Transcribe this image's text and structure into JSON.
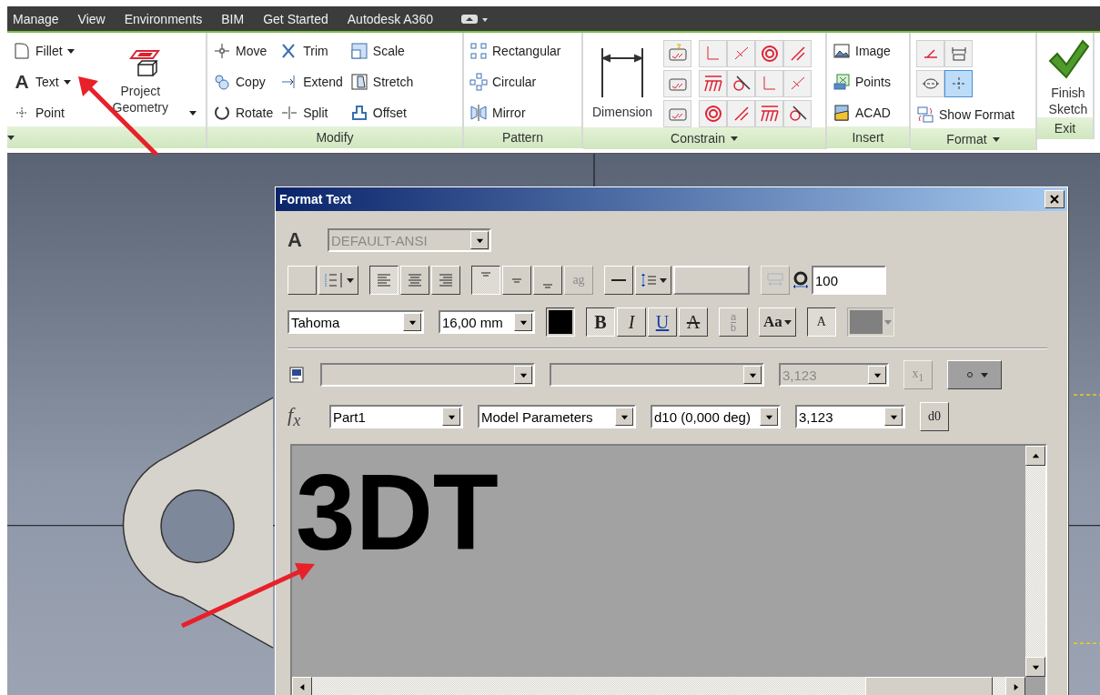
{
  "menu_tabs": [
    "Manage",
    "View",
    "Environments",
    "BIM",
    "Get Started",
    "Autodesk A360"
  ],
  "ribbon": [
    {
      "menu": true,
      "sections": [
        {
          "kind": "tools",
          "items": [
            {
              "label": "Fillet",
              "dropdown": true
            },
            {
              "label": "Text",
              "glyph": "A",
              "dropdown": true
            },
            {
              "label": "Point",
              "dropdown": false
            }
          ]
        },
        {
          "kind": "large",
          "label": "Project Geometry",
          "dropdown": true
        }
      ]
    },
    {
      "title": "Modify",
      "menu": false,
      "sections": [
        {
          "kind": "tools",
          "items": [
            {
              "label": "Move",
              "dropdown": false
            },
            {
              "label": "Copy",
              "dropdown": false
            },
            {
              "label": "Rotate",
              "dropdown": false
            }
          ]
        },
        {
          "kind": "tools",
          "items": [
            {
              "label": "Trim",
              "dropdown": false
            },
            {
              "label": "Extend",
              "dropdown": false
            },
            {
              "label": "Split",
              "dropdown": false
            }
          ]
        },
        {
          "kind": "tools",
          "items": [
            {
              "label": "Scale",
              "dropdown": false
            },
            {
              "label": "Stretch",
              "dropdown": false
            },
            {
              "label": "Offset",
              "dropdown": false
            }
          ]
        }
      ]
    },
    {
      "title": "Pattern",
      "menu": false,
      "sections": [
        {
          "kind": "tools",
          "items": [
            {
              "label": "Rectangular",
              "dropdown": false
            },
            {
              "label": "Circular",
              "dropdown": false
            },
            {
              "label": "Mirror",
              "dropdown": false
            }
          ]
        }
      ]
    },
    {
      "title": "Constrain",
      "menu": true,
      "sections": [
        {
          "kind": "large",
          "label": "Dimension",
          "dropdown": false
        },
        {
          "kind": "grid",
          "rows": [
            [
              {
                "selected": false
              }
            ],
            [
              {
                "selected": false
              }
            ],
            [
              {
                "selected": false
              }
            ]
          ]
        },
        {
          "kind": "grid",
          "rows": [
            [
              {
                "selected": false
              },
              {
                "selected": false
              },
              {
                "selected": false
              },
              {
                "selected": false
              }
            ],
            [
              {
                "selected": false
              },
              {
                "selected": false
              },
              {
                "selected": false
              },
              {
                "selected": false
              }
            ],
            [
              {
                "selected": false
              },
              {
                "selected": false
              },
              {
                "selected": false
              },
              {
                "selected": false
              }
            ]
          ]
        }
      ]
    },
    {
      "title": "Insert",
      "menu": false,
      "sections": [
        {
          "kind": "tools",
          "items": [
            {
              "label": "Image",
              "dropdown": false
            },
            {
              "label": "Points",
              "dropdown": false
            },
            {
              "label": "ACAD",
              "dropdown": false
            }
          ]
        }
      ]
    },
    {
      "title": "Format",
      "menu": true,
      "sections": [
        {
          "kind": "grid",
          "rows": [
            [
              {
                "selected": false
              },
              {
                "selected": false
              }
            ],
            [
              {
                "selected": false
              },
              {
                "selected": true
              }
            ]
          ],
          "items": [
            {
              "label": "Show Format",
              "dropdown": false
            }
          ]
        }
      ]
    },
    {
      "title": "Exit",
      "menu": false,
      "sections": [
        {
          "kind": "large",
          "label": "Finish Sketch",
          "dropdown": false
        }
      ]
    }
  ],
  "dialog": {
    "title": "Format Text",
    "style_row": {
      "glyph": "A",
      "combo": {
        "kind": "combo",
        "value": "DEFAULT-ANSI",
        "disabled": true
      }
    },
    "paragraph_row": [
      [
        {
          "kind": "button",
          "selected": false,
          "disabled": false
        },
        {
          "kind": "menu-button",
          "selected": false,
          "disabled": false
        }
      ],
      [
        {
          "kind": "button",
          "selected": true,
          "disabled": false
        },
        {
          "kind": "button",
          "selected": false,
          "disabled": false
        },
        {
          "kind": "button",
          "selected": false,
          "disabled": false
        }
      ],
      [
        {
          "kind": "button",
          "selected": true,
          "disabled": false
        },
        {
          "kind": "button",
          "selected": false,
          "disabled": false
        },
        {
          "kind": "button",
          "selected": false,
          "disabled": false
        },
        {
          "kind": "button",
          "glyph": "ag",
          "selected": false,
          "disabled": true
        }
      ],
      [
        {
          "kind": "button",
          "selected": false,
          "disabled": false
        },
        {
          "kind": "menu-button",
          "selected": false,
          "disabled": false
        },
        {
          "kind": "field",
          "disabled": true
        }
      ],
      [
        {
          "kind": "button",
          "selected": false,
          "disabled": true
        },
        {
          "kind": "icon"
        },
        {
          "kind": "field",
          "value": "100",
          "disabled": false
        }
      ]
    ],
    "font_row": [
      [
        {
          "kind": "combo",
          "value": "Tahoma",
          "disabled": false
        },
        {
          "kind": "combo",
          "value": "16,00 mm",
          "disabled": false
        }
      ],
      [
        {
          "kind": "swatch",
          "color": "#000000",
          "dropdown": false,
          "disabled": false
        }
      ],
      [
        {
          "kind": "button",
          "glyph": "B",
          "selected": true,
          "disabled": false
        },
        {
          "kind": "button",
          "glyph": "I",
          "selected": false,
          "disabled": false
        },
        {
          "kind": "button",
          "glyph": "U",
          "selected": false,
          "disabled": false
        },
        {
          "kind": "button",
          "glyph": "A",
          "selected": false,
          "disabled": false
        }
      ],
      [
        {
          "kind": "stack",
          "top": "a",
          "bottom": "b",
          "disabled": true
        }
      ],
      [
        {
          "kind": "menu-button",
          "glyph": "Aa",
          "selected": false,
          "disabled": false
        }
      ],
      [
        {
          "kind": "button",
          "glyph": "A",
          "selected": true,
          "disabled": false
        }
      ],
      [
        {
          "kind": "swatch",
          "color": "#808080",
          "dropdown": true,
          "disabled": true
        }
      ]
    ],
    "parameter_rows": [
      [
        {
          "kind": "icon"
        },
        {
          "kind": "combo",
          "disabled": true
        },
        {
          "kind": "combo",
          "disabled": true
        },
        {
          "kind": "combo",
          "value": "3,123",
          "disabled": true
        },
        {
          "kind": "button",
          "glyph": "x$_{1}$",
          "selected": false,
          "disabled": true
        },
        {
          "kind": "menu-button",
          "selected": false,
          "disabled": false
        }
      ],
      [
        {
          "kind": "label",
          "glyph": "f$_{x}$"
        },
        {
          "kind": "combo",
          "value": "Part1",
          "disabled": false
        },
        {
          "kind": "combo",
          "value": "Model Parameters",
          "disabled": false
        },
        {
          "kind": "combo",
          "value": "d10 (0,000 deg)",
          "disabled": false
        },
        {
          "kind": "combo",
          "value": "3,123",
          "disabled": false
        },
        {
          "kind": "button",
          "glyph": "d0",
          "selected": false,
          "disabled": false
        }
      ]
    ],
    "text": "3DT"
  }
}
